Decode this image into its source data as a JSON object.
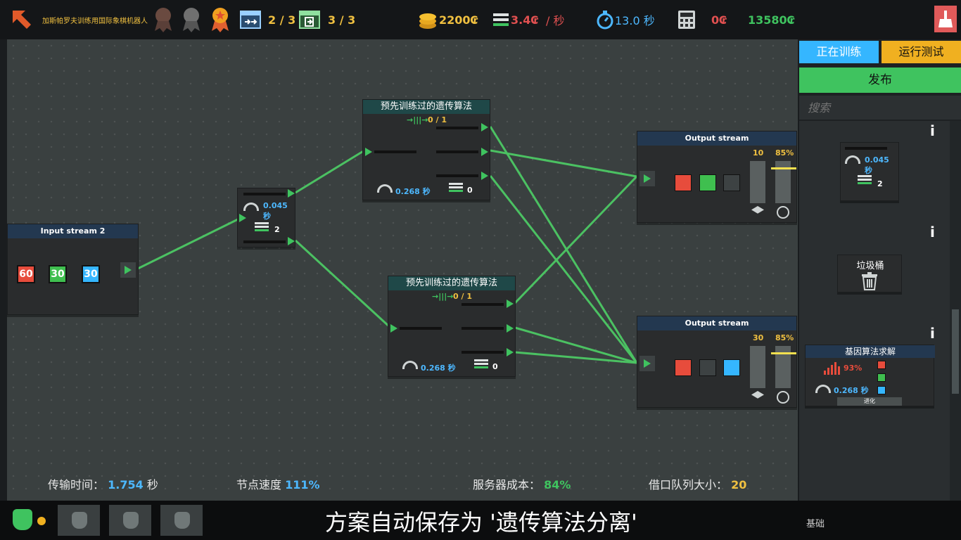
{
  "topbar": {
    "title": "加斯帕罗夫训练用国际象棋机器人",
    "level_a": "2 / 3",
    "level_b": "3 / 3",
    "money": "2200₢",
    "income": "3.4₢",
    "income_unit": "/ 秒",
    "timer": "13.0 秒",
    "cost": "0₢",
    "score": "13580₢"
  },
  "canvas": {
    "input_node": {
      "title": "Input stream 2",
      "values": [
        "60",
        "30",
        "30"
      ]
    },
    "splitter": {
      "speed": "0.045 秒",
      "count": "2"
    },
    "gen_top": {
      "title": "预先训练过的遗传算法",
      "ratio": "0 / 1",
      "speed": "0.268 秒",
      "count": "0"
    },
    "gen_bottom": {
      "title": "预先训练过的遗传算法",
      "ratio": "0 / 1",
      "speed": "0.268 秒",
      "count": "0"
    },
    "output_top": {
      "title": "Output stream",
      "count": "10",
      "percent": "85%"
    },
    "output_bottom": {
      "title": "Output stream",
      "count": "30",
      "percent": "85%"
    }
  },
  "stats": {
    "transfer_label": "传输时间：",
    "transfer_value": "1.754",
    "transfer_unit": "秒",
    "node_speed_label": "节点速度",
    "node_speed_value": "111%",
    "server_cost_label": "服务器成本：",
    "server_cost_value": "84%",
    "queue_label": "借口队列大小：",
    "queue_value": "20"
  },
  "sidebar": {
    "tab_training": "正在训练",
    "tab_test": "运行测试",
    "publish": "发布",
    "search_placeholder": "搜索",
    "splitter_speed": "0.045 秒",
    "splitter_count": "2",
    "trash_label": "垃圾桶",
    "genetic_title": "基因算法求解",
    "genetic_percent": "93%",
    "genetic_speed": "0.268 秒",
    "genetic_evolve": "进化",
    "info": "i"
  },
  "bottom": {
    "autosave": "方案自动保存为 '遗传算法分离'",
    "partial_text": "基础"
  },
  "colors": {
    "wire": "#4fd868",
    "accent_red": "#e74c3c",
    "accent_green": "#3fbf4f",
    "accent_blue": "#35b6ff",
    "yellow": "#f4d03f"
  }
}
